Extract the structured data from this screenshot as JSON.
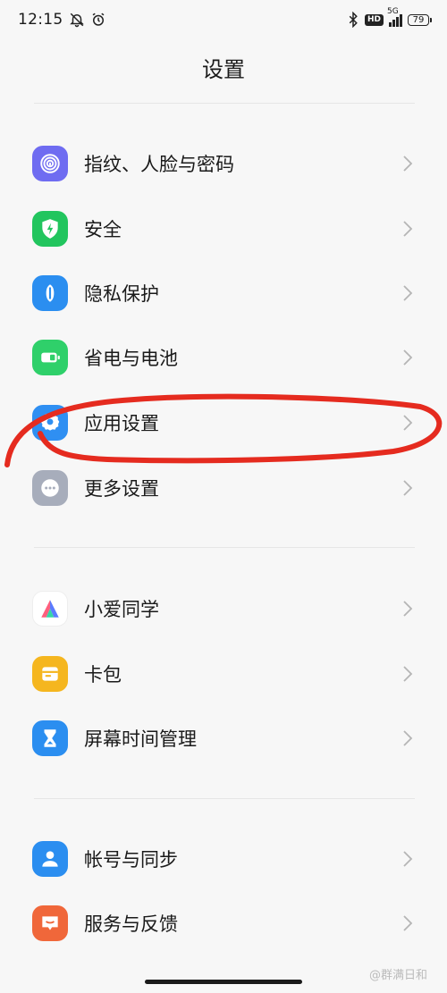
{
  "status_bar": {
    "time": "12:15",
    "network": "5G",
    "hd_label": "HD",
    "battery": "79"
  },
  "page_title": "设置",
  "groups": [
    {
      "items": [
        {
          "label": "指纹、人脸与密码",
          "icon": "fingerprint-icon",
          "color": "#6f6cf1"
        },
        {
          "label": "安全",
          "icon": "shield-bolt-icon",
          "color": "#22c55e"
        },
        {
          "label": "隐私保护",
          "icon": "privacy-icon",
          "color": "#2b8ef0"
        },
        {
          "label": "省电与电池",
          "icon": "battery-icon",
          "color": "#2fd06a"
        },
        {
          "label": "应用设置",
          "icon": "gear-icon",
          "color": "#2f8ff2"
        },
        {
          "label": "更多设置",
          "icon": "more-dots-icon",
          "color": "#a7adbb"
        }
      ]
    },
    {
      "items": [
        {
          "label": "小爱同学",
          "icon": "xiaoai-icon",
          "color": "#ffffff"
        },
        {
          "label": "卡包",
          "icon": "card-wallet-icon",
          "color": "#f5b61f"
        },
        {
          "label": "屏幕时间管理",
          "icon": "hourglass-icon",
          "color": "#2b8ef0"
        }
      ]
    },
    {
      "items": [
        {
          "label": "帐号与同步",
          "icon": "account-icon",
          "color": "#2b8ef0"
        },
        {
          "label": "服务与反馈",
          "icon": "feedback-icon",
          "color": "#f0673a"
        }
      ]
    }
  ],
  "watermark": "@群满日和",
  "annotation_color": "#e52b1f"
}
